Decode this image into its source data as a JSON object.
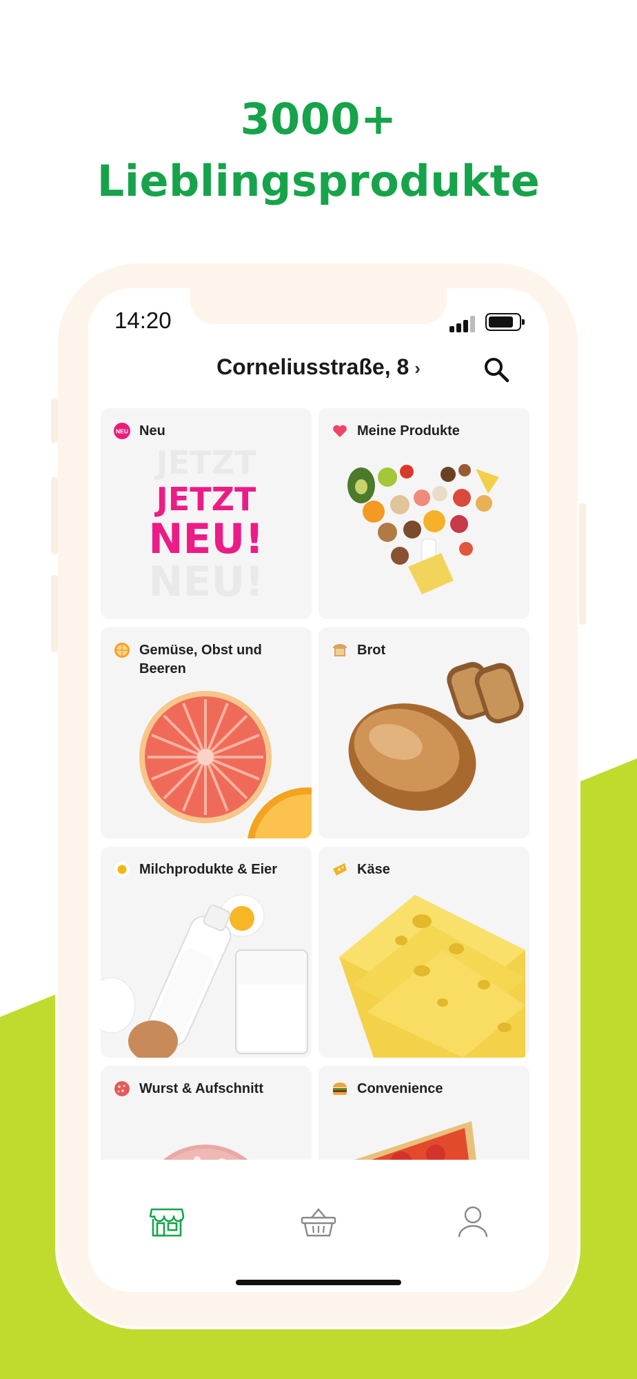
{
  "colors": {
    "brand_green": "#16a34a",
    "lime": "#c0da2e",
    "phone_frame": "#fdf5ec",
    "neu_pink": "#e91e7a"
  },
  "headline": {
    "line1": "3000+",
    "line2": "Lieblingsprodukte"
  },
  "status_bar": {
    "time": "14:20"
  },
  "header": {
    "address": "Corneliusstraße, 8",
    "chevron": "›",
    "search_icon": "search-icon"
  },
  "categories": [
    {
      "label": "Neu",
      "icon": "neu-badge-icon",
      "badge": "NEU",
      "art_text": [
        "JETZT",
        "NEU!"
      ]
    },
    {
      "label": "Meine Produkte",
      "icon": "heart-icon"
    },
    {
      "label": "Gemüse, Obst und Beeren",
      "icon": "orange-slice-icon"
    },
    {
      "label": "Brot",
      "icon": "bread-icon"
    },
    {
      "label": "Milchprodukte & Eier",
      "icon": "egg-yolk-icon"
    },
    {
      "label": "Käse",
      "icon": "cheese-icon"
    },
    {
      "label": "Wurst & Aufschnitt",
      "icon": "salami-icon"
    },
    {
      "label": "Convenience",
      "icon": "burger-icon"
    }
  ],
  "tabbar": [
    {
      "icon": "store-icon",
      "active": true
    },
    {
      "icon": "basket-icon",
      "active": false
    },
    {
      "icon": "profile-icon",
      "active": false
    }
  ]
}
